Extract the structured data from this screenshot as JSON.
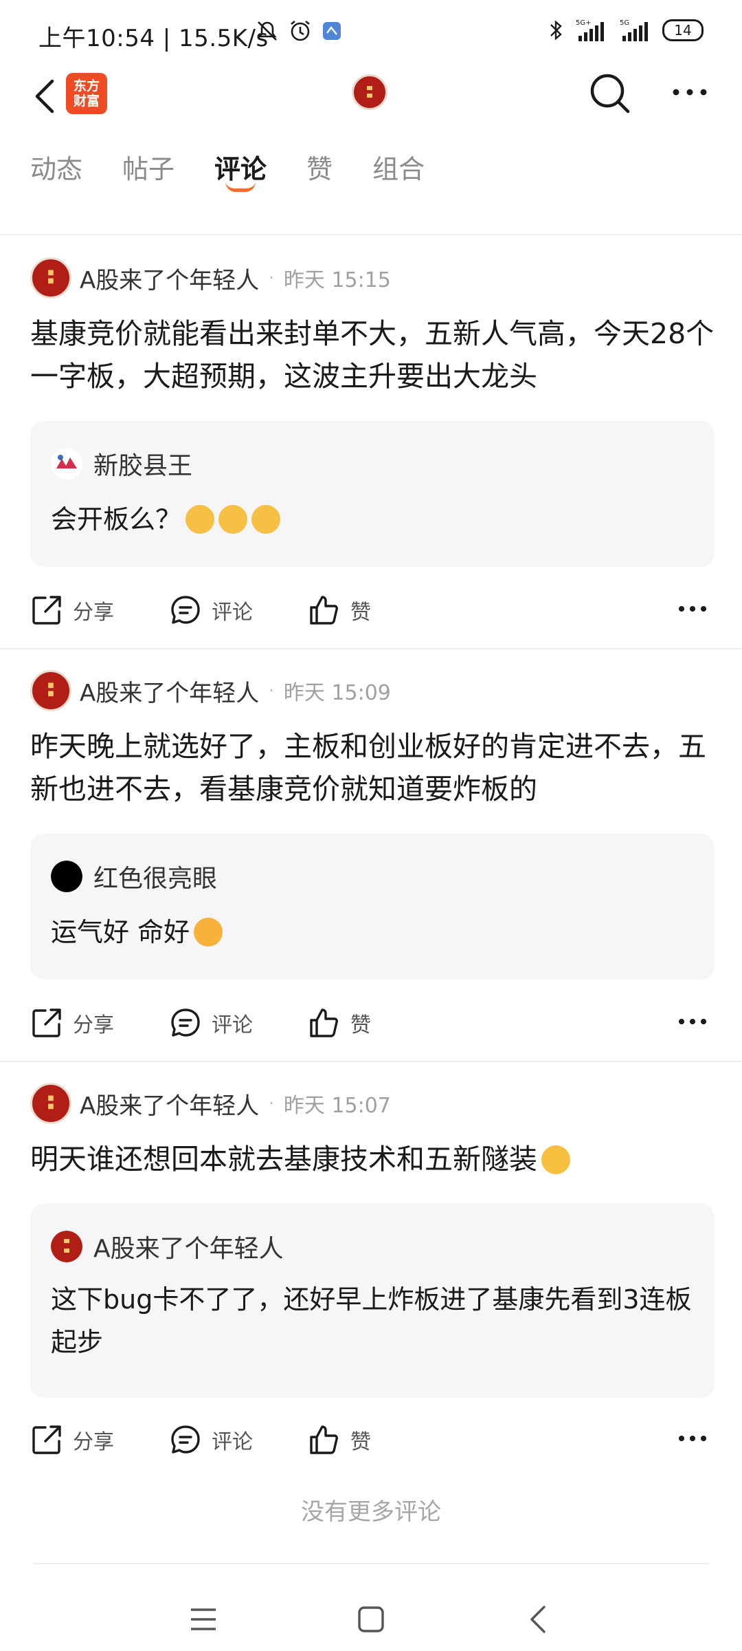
{
  "status": {
    "time": "上午10:54 | 15.5K/s",
    "battery": "14",
    "signal_labels": [
      "5G+",
      "5G"
    ]
  },
  "nav": {
    "brand_line1": "东方",
    "brand_line2": "财富"
  },
  "tabs": [
    {
      "label": "动态"
    },
    {
      "label": "帖子"
    },
    {
      "label": "评论"
    },
    {
      "label": "赞"
    },
    {
      "label": "组合"
    }
  ],
  "posts": [
    {
      "username": "A股来了个年轻人",
      "time": "昨天 15:15",
      "text": "基康竞价就能看出来封单不大，五新人气高，今天28个一字板，大超预期，这波主升要出大龙头",
      "quote": {
        "username": "新胶县王",
        "text": "会开板么？"
      }
    },
    {
      "username": "A股来了个年轻人",
      "time": "昨天 15:09",
      "text": "昨天晚上就选好了，主板和创业板好的肯定进不去，五新也进不去，看基康竞价就知道要炸板的",
      "quote": {
        "username": "红色很亮眼",
        "text": "运气好 命好"
      }
    },
    {
      "username": "A股来了个年轻人",
      "time": "昨天 15:07",
      "text": "明天谁还想回本就去基康技术和五新隧装",
      "quote": {
        "username": "A股来了个年轻人",
        "text": "这下bug卡不了了，还好早上炸板进了基康先看到3连板起步"
      }
    }
  ],
  "actions": {
    "share": "分享",
    "comment": "评论",
    "like": "赞"
  },
  "footer": {
    "no_more": "没有更多评论"
  },
  "colors": {
    "accent": "#ff6a2a",
    "brand": "#ef4b24",
    "avatar_red": "#b01e16"
  }
}
